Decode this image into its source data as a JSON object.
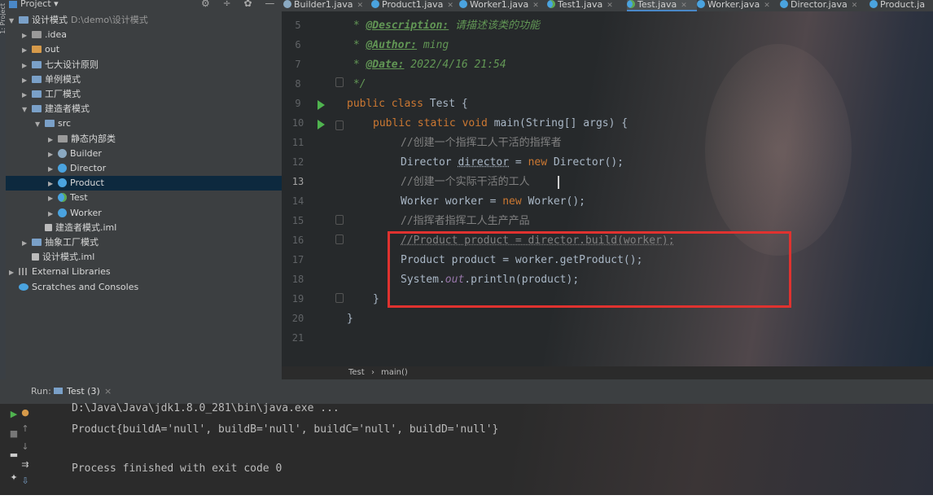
{
  "sidebar_strip": {
    "label": "1: Project"
  },
  "project_panel": {
    "title": "Project ▾",
    "tool_icons": [
      "⚙ ÷",
      "✿ —"
    ],
    "tree": [
      {
        "indent": 0,
        "arrow": "▼",
        "icon": "folder-blue",
        "label": "设计模式",
        "path": "D:\\demo\\设计模式"
      },
      {
        "indent": 1,
        "arrow": "▶",
        "icon": "folder-gray",
        "label": ".idea"
      },
      {
        "indent": 1,
        "arrow": "▶",
        "icon": "folder-orange",
        "label": "out"
      },
      {
        "indent": 1,
        "arrow": "▶",
        "icon": "folder-blue",
        "label": "七大设计原则"
      },
      {
        "indent": 1,
        "arrow": "▶",
        "icon": "folder-blue",
        "label": "单例模式"
      },
      {
        "indent": 1,
        "arrow": "▶",
        "icon": "folder-blue",
        "label": "工厂模式"
      },
      {
        "indent": 1,
        "arrow": "▼",
        "icon": "folder-blue",
        "label": "建造者模式"
      },
      {
        "indent": 2,
        "arrow": "▼",
        "icon": "folder-blue",
        "label": "src"
      },
      {
        "indent": 3,
        "arrow": "▶",
        "icon": "folder-gray",
        "label": "静态内部类"
      },
      {
        "indent": 3,
        "arrow": "▶",
        "icon": "class-gray",
        "label": "Builder"
      },
      {
        "indent": 3,
        "arrow": "▶",
        "icon": "class",
        "label": "Director"
      },
      {
        "indent": 3,
        "arrow": "▶",
        "icon": "class",
        "label": "Product",
        "selected": true
      },
      {
        "indent": 3,
        "arrow": "▶",
        "icon": "class-green",
        "label": "Test"
      },
      {
        "indent": 3,
        "arrow": "▶",
        "icon": "class",
        "label": "Worker"
      },
      {
        "indent": 2,
        "arrow": "",
        "icon": "file",
        "label": "建造者模式.iml"
      },
      {
        "indent": 1,
        "arrow": "▶",
        "icon": "folder-blue",
        "label": "抽象工厂模式"
      },
      {
        "indent": 1,
        "arrow": "",
        "icon": "file",
        "label": "设计模式.iml"
      },
      {
        "indent": 0,
        "arrow": "▶",
        "icon": "libs",
        "label": "External Libraries"
      },
      {
        "indent": 0,
        "arrow": "",
        "icon": "scratch",
        "label": "Scratches and Consoles"
      }
    ]
  },
  "tabs": [
    {
      "label": "Builder1.java",
      "active": false
    },
    {
      "label": "Product1.java",
      "active": false
    },
    {
      "label": "Worker1.java",
      "active": false
    },
    {
      "label": "Test1.java",
      "active": false
    },
    {
      "label": "Test.java",
      "active": true
    },
    {
      "label": "Worker.java",
      "active": false
    },
    {
      "label": "Director.java",
      "active": false
    },
    {
      "label": "Product.ja",
      "active": false
    }
  ],
  "editor": {
    "lines": [
      {
        "n": "5"
      },
      {
        "n": "6"
      },
      {
        "n": "7"
      },
      {
        "n": "8"
      },
      {
        "n": "9"
      },
      {
        "n": "10"
      },
      {
        "n": "11"
      },
      {
        "n": "12"
      },
      {
        "n": "13"
      },
      {
        "n": "14"
      },
      {
        "n": "15"
      },
      {
        "n": "16"
      },
      {
        "n": "17"
      },
      {
        "n": "18"
      },
      {
        "n": "19"
      },
      {
        "n": "20"
      },
      {
        "n": "21"
      }
    ],
    "code": {
      "l5_star": " * ",
      "l5_tag": "@Description:",
      "l5_text": " 请描述该类的功能",
      "l6_star": " * ",
      "l6_tag": "@Author:",
      "l6_text": " ming",
      "l7_star": " * ",
      "l7_tag": "@Date:",
      "l7_text": " 2022/4/16 21:54",
      "l8": " */",
      "l9_kw": "public class",
      "l9_rest": " Test {",
      "l10_kw": "public static void",
      "l10_rest": " main(String[] args) {",
      "l11": "//创建一个指挥工人干活的指挥者",
      "l12_a": "Director ",
      "l12_b": "director",
      "l12_c": " = ",
      "l12_kw": "new",
      "l12_d": " Director();",
      "l13": "//创建一个实际干活的工人",
      "l14_a": "Worker worker = ",
      "l14_kw": "new",
      "l14_d": " Worker();",
      "l15": "//指挥者指挥工人生产产品",
      "l16": "//Product product = director.build(worker);",
      "l17": "Product product = worker.getProduct();",
      "l18_a": "System.",
      "l18_f": "out",
      "l18_b": ".println(product);",
      "l19": "}",
      "l20": "}"
    }
  },
  "breadcrumb": {
    "a": "Test",
    "sep": "›",
    "b": "main()"
  },
  "run_panel": {
    "label": "Run:",
    "tab": "Test (3)",
    "tab_close": "×",
    "output": [
      "D:\\Java\\Java\\jdk1.8.0_281\\bin\\java.exe ...",
      "Product{buildA='null', buildB='null', buildC='null', buildD='null'}",
      "",
      "Process finished with exit code 0"
    ]
  },
  "colors": {
    "accent": "#4a88c7",
    "run_green": "#4fb34f",
    "highlight_box": "#e0322f"
  }
}
